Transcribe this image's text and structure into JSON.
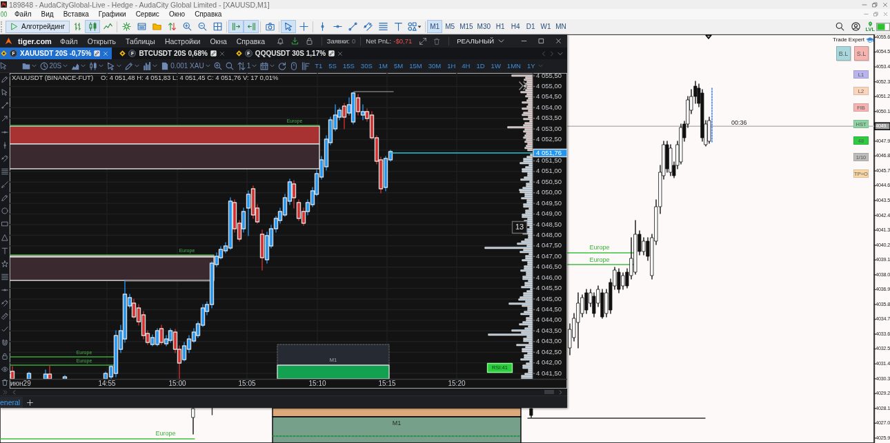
{
  "window": {
    "title": "189848 - AudaCityGlobal-Live - Hedge - AudaCity Global Limited - [XAUUSD,M1]"
  },
  "menu": [
    "Файл",
    "Вид",
    "Вставка",
    "Графики",
    "Сервис",
    "Окно",
    "Справка"
  ],
  "toolbar": {
    "algo_button": "Алготрейдинг",
    "tool_buttons": [
      {
        "active": false
      },
      {
        "active": true
      },
      {
        "active": false
      },
      {
        "active": false
      },
      {
        "active": false
      },
      {
        "active": false
      },
      {
        "active": false
      },
      {
        "active": false
      },
      {
        "active": false
      },
      {
        "active": false
      },
      {
        "active": true
      },
      {
        "active": true
      },
      {
        "active": false
      },
      {
        "active": true
      },
      {
        "active": false
      },
      {
        "active": false
      },
      {
        "active": false
      },
      {
        "active": false
      },
      {
        "active": false
      },
      {
        "active": false
      },
      {
        "active": false
      },
      {
        "active": false
      }
    ],
    "timeframes": [
      {
        "label": "M1",
        "selected": true
      },
      {
        "label": "M5",
        "selected": false
      },
      {
        "label": "M15",
        "selected": false
      },
      {
        "label": "M30",
        "selected": false
      },
      {
        "label": "H1",
        "selected": false
      },
      {
        "label": "H4",
        "selected": false
      },
      {
        "label": "D1",
        "selected": false
      },
      {
        "label": "W1",
        "selected": false
      },
      {
        "label": "MN",
        "selected": false
      }
    ],
    "level_label": "LVL"
  },
  "chart": {
    "price_axis_upper": [
      "4055.6",
      "4054.5",
      "4053.4",
      "4052.3",
      "4051.2",
      "4050.1"
    ],
    "current_price": "4049.",
    "price_axis_lower": [
      "4047.9",
      "4046.8",
      "4045.7",
      "4044.6",
      "4043.5",
      "4042.4",
      "4041.3",
      "4040.2",
      "4039.1",
      "4038.0",
      "4036.9",
      "4035.8",
      "4034.7",
      "4033.6",
      "4032.5",
      "4031.4",
      "4030.3",
      "4029.2",
      "4028.1",
      "4027.0",
      "4025.9"
    ],
    "candle_timer": "00:36",
    "session_labels": [
      "Europe",
      "Europe",
      "Europe"
    ],
    "box_label": "M1",
    "trade_panel": {
      "title": "Trade Expert",
      "buttons": [
        {
          "label": "B.L",
          "color": "#a9d8dc"
        },
        {
          "label": "S.L",
          "color": "#f6b4b0"
        },
        {
          "label": "L1",
          "color": "#b9b3ee"
        },
        {
          "label": "L2",
          "color": "#fbd4bc"
        },
        {
          "label": "FIB",
          "color": "#f7b2b2"
        },
        {
          "label": "HST",
          "color": "#8ed4a3"
        },
        {
          "label": "48",
          "color": "#2ecc40"
        },
        {
          "label": "1/10",
          "color": "#bdbdbd"
        },
        {
          "label": "TP=O",
          "color": "#fbd6a6"
        }
      ]
    }
  },
  "tiger": {
    "brand": "tiger.com",
    "menu": [
      "Файл",
      "Открыть",
      "Таблицы",
      "Настройки",
      "Окна",
      "Справка"
    ],
    "orders_label": "Заявки:",
    "orders_count": "0",
    "pnl_label": "Net PnL:",
    "pnl_value": "-$0,71",
    "account_mode": "РЕАЛЬНЫЙ",
    "tabs": [
      {
        "badge": "F",
        "label": "XAUUSDT 20S -0,75%",
        "selected": true
      },
      {
        "badge": "F",
        "label": "BTCUSDT 20S 0,68%",
        "selected": false
      },
      {
        "badge": "F",
        "label": "QQQUSDT 30S 1,17%",
        "selected": false
      }
    ],
    "toolbar": {
      "interval": "20S",
      "quantity": "0.001 XAU",
      "layout_count": "1",
      "timeframes": [
        "T1",
        "5S",
        "15S",
        "30S",
        "1M",
        "5M",
        "15M",
        "30M",
        "1H",
        "4H",
        "1D",
        "1W",
        "1MN",
        "1Y"
      ]
    },
    "info_symbol": "XAUUSDT (BINANCE-FUT)",
    "info_values": "O: 4 051,48 H: 4 051,83 L: 4 051,45 C: 4 051,76 V: 17 0,01%",
    "chart": {
      "session_labels": [
        "Europe",
        "Europe",
        "Europe",
        "Europe"
      ],
      "bar_count": "13",
      "box_label": "M1",
      "rsi_label": "RSI:41",
      "price_axis_upper": [
        "4 055,50",
        "4 055,00",
        "4 054,50",
        "4 054,00",
        "4 053,50",
        "4 053,00",
        "4 052,50"
      ],
      "current_price": "4 051,76",
      "price_axis_lower": [
        "4 051,50",
        "4 051,00",
        "4 050,50",
        "4 050,00",
        "4 049,50",
        "4 049,00",
        "4 048,50",
        "4 048,00",
        "4 047,50",
        "4 047,00",
        "4 046,50",
        "4 046,00",
        "4 045,50",
        "4 045,00",
        "4 044,50",
        "4 044,00",
        "4 043,50",
        "4 043,00",
        "4 042,50",
        "4 042,00",
        "4 041,50"
      ],
      "time_axis": [
        "июн29",
        "14:55",
        "15:00",
        "15:05",
        "15:10",
        "15:15",
        "15:20"
      ]
    },
    "bottom_tabs": [
      {
        "label": "eneral",
        "selected": true
      }
    ]
  }
}
